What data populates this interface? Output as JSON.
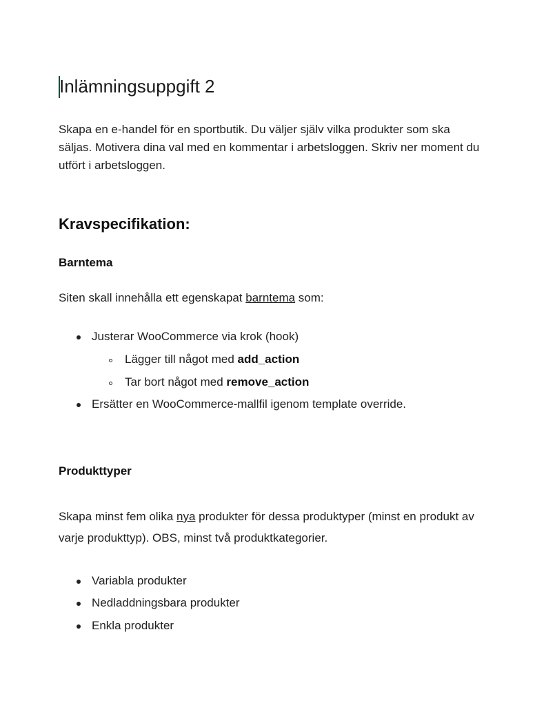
{
  "document": {
    "title": "Inlämningsuppgift 2",
    "intro": "Skapa en e-handel för en sportbutik. Du väljer själv vilka produkter som ska  säljas. Motivera dina val med en kommentar i arbetsloggen. Skriv ner moment du utfört i arbetsloggen.",
    "heading": "Kravspecifikation:",
    "barntema": {
      "heading": "Barntema",
      "para_before": "Siten skall innehålla ett egenskapat ",
      "para_link": "barntema",
      "para_after": " som:",
      "items": [
        {
          "text": "Justerar WooCommerce via krok (hook)"
        },
        {
          "text": "Lägger till något med ",
          "code": "add_action"
        },
        {
          "text": "Tar bort något med ",
          "code": "remove_action"
        },
        {
          "text": "Ersätter en WooCommerce-mallfil igenom template override."
        }
      ]
    },
    "produkttyper": {
      "heading": "Produkttyper",
      "para_before": "Skapa minst fem olika ",
      "para_underline": "nya",
      "para_after": " produkter för dessa produktyper (minst en produkt av varje produkttyp). OBS, minst två produktkategorier.",
      "items": [
        {
          "text": "Variabla produkter"
        },
        {
          "text": "Nedladdningsbara produkter"
        },
        {
          "text": "Enkla produkter"
        }
      ]
    }
  }
}
